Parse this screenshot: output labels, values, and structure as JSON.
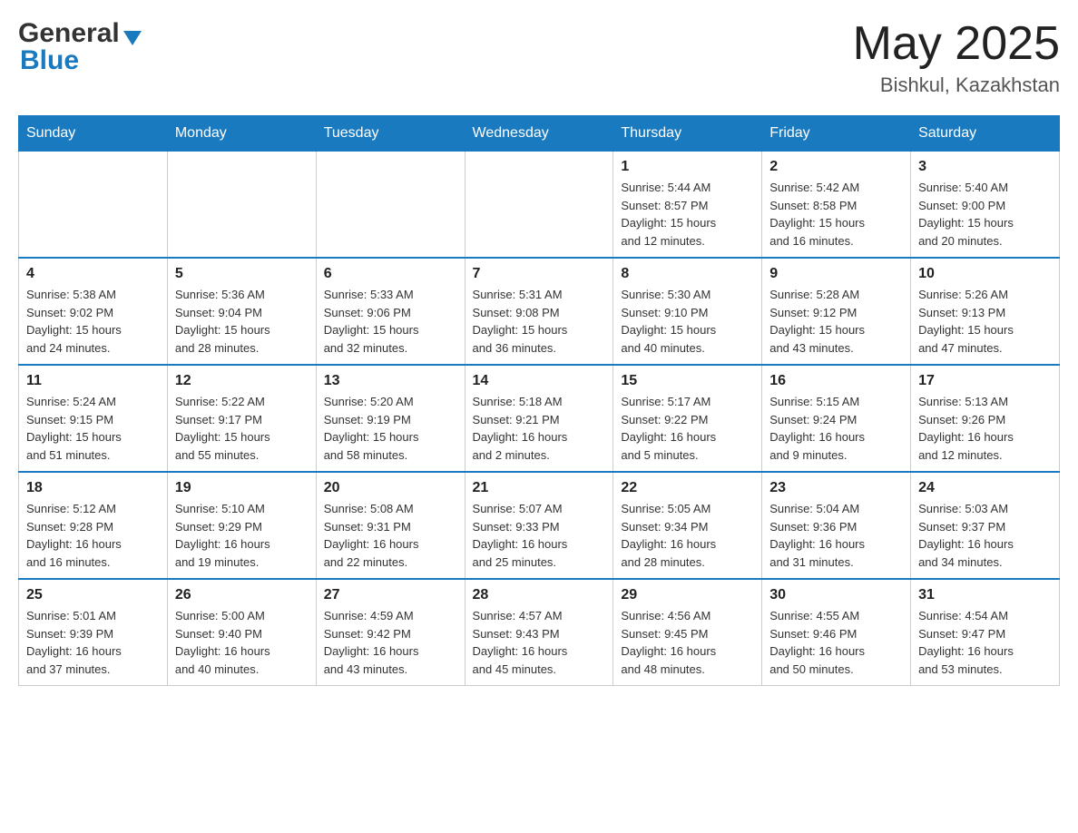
{
  "header": {
    "logo": {
      "general": "General",
      "blue": "Blue",
      "arrow": "arrow-down"
    },
    "title": "May 2025",
    "location": "Bishkul, Kazakhstan"
  },
  "calendar": {
    "days_of_week": [
      "Sunday",
      "Monday",
      "Tuesday",
      "Wednesday",
      "Thursday",
      "Friday",
      "Saturday"
    ],
    "weeks": [
      [
        {
          "day": "",
          "info": ""
        },
        {
          "day": "",
          "info": ""
        },
        {
          "day": "",
          "info": ""
        },
        {
          "day": "",
          "info": ""
        },
        {
          "day": "1",
          "info": "Sunrise: 5:44 AM\nSunset: 8:57 PM\nDaylight: 15 hours\nand 12 minutes."
        },
        {
          "day": "2",
          "info": "Sunrise: 5:42 AM\nSunset: 8:58 PM\nDaylight: 15 hours\nand 16 minutes."
        },
        {
          "day": "3",
          "info": "Sunrise: 5:40 AM\nSunset: 9:00 PM\nDaylight: 15 hours\nand 20 minutes."
        }
      ],
      [
        {
          "day": "4",
          "info": "Sunrise: 5:38 AM\nSunset: 9:02 PM\nDaylight: 15 hours\nand 24 minutes."
        },
        {
          "day": "5",
          "info": "Sunrise: 5:36 AM\nSunset: 9:04 PM\nDaylight: 15 hours\nand 28 minutes."
        },
        {
          "day": "6",
          "info": "Sunrise: 5:33 AM\nSunset: 9:06 PM\nDaylight: 15 hours\nand 32 minutes."
        },
        {
          "day": "7",
          "info": "Sunrise: 5:31 AM\nSunset: 9:08 PM\nDaylight: 15 hours\nand 36 minutes."
        },
        {
          "day": "8",
          "info": "Sunrise: 5:30 AM\nSunset: 9:10 PM\nDaylight: 15 hours\nand 40 minutes."
        },
        {
          "day": "9",
          "info": "Sunrise: 5:28 AM\nSunset: 9:12 PM\nDaylight: 15 hours\nand 43 minutes."
        },
        {
          "day": "10",
          "info": "Sunrise: 5:26 AM\nSunset: 9:13 PM\nDaylight: 15 hours\nand 47 minutes."
        }
      ],
      [
        {
          "day": "11",
          "info": "Sunrise: 5:24 AM\nSunset: 9:15 PM\nDaylight: 15 hours\nand 51 minutes."
        },
        {
          "day": "12",
          "info": "Sunrise: 5:22 AM\nSunset: 9:17 PM\nDaylight: 15 hours\nand 55 minutes."
        },
        {
          "day": "13",
          "info": "Sunrise: 5:20 AM\nSunset: 9:19 PM\nDaylight: 15 hours\nand 58 minutes."
        },
        {
          "day": "14",
          "info": "Sunrise: 5:18 AM\nSunset: 9:21 PM\nDaylight: 16 hours\nand 2 minutes."
        },
        {
          "day": "15",
          "info": "Sunrise: 5:17 AM\nSunset: 9:22 PM\nDaylight: 16 hours\nand 5 minutes."
        },
        {
          "day": "16",
          "info": "Sunrise: 5:15 AM\nSunset: 9:24 PM\nDaylight: 16 hours\nand 9 minutes."
        },
        {
          "day": "17",
          "info": "Sunrise: 5:13 AM\nSunset: 9:26 PM\nDaylight: 16 hours\nand 12 minutes."
        }
      ],
      [
        {
          "day": "18",
          "info": "Sunrise: 5:12 AM\nSunset: 9:28 PM\nDaylight: 16 hours\nand 16 minutes."
        },
        {
          "day": "19",
          "info": "Sunrise: 5:10 AM\nSunset: 9:29 PM\nDaylight: 16 hours\nand 19 minutes."
        },
        {
          "day": "20",
          "info": "Sunrise: 5:08 AM\nSunset: 9:31 PM\nDaylight: 16 hours\nand 22 minutes."
        },
        {
          "day": "21",
          "info": "Sunrise: 5:07 AM\nSunset: 9:33 PM\nDaylight: 16 hours\nand 25 minutes."
        },
        {
          "day": "22",
          "info": "Sunrise: 5:05 AM\nSunset: 9:34 PM\nDaylight: 16 hours\nand 28 minutes."
        },
        {
          "day": "23",
          "info": "Sunrise: 5:04 AM\nSunset: 9:36 PM\nDaylight: 16 hours\nand 31 minutes."
        },
        {
          "day": "24",
          "info": "Sunrise: 5:03 AM\nSunset: 9:37 PM\nDaylight: 16 hours\nand 34 minutes."
        }
      ],
      [
        {
          "day": "25",
          "info": "Sunrise: 5:01 AM\nSunset: 9:39 PM\nDaylight: 16 hours\nand 37 minutes."
        },
        {
          "day": "26",
          "info": "Sunrise: 5:00 AM\nSunset: 9:40 PM\nDaylight: 16 hours\nand 40 minutes."
        },
        {
          "day": "27",
          "info": "Sunrise: 4:59 AM\nSunset: 9:42 PM\nDaylight: 16 hours\nand 43 minutes."
        },
        {
          "day": "28",
          "info": "Sunrise: 4:57 AM\nSunset: 9:43 PM\nDaylight: 16 hours\nand 45 minutes."
        },
        {
          "day": "29",
          "info": "Sunrise: 4:56 AM\nSunset: 9:45 PM\nDaylight: 16 hours\nand 48 minutes."
        },
        {
          "day": "30",
          "info": "Sunrise: 4:55 AM\nSunset: 9:46 PM\nDaylight: 16 hours\nand 50 minutes."
        },
        {
          "day": "31",
          "info": "Sunrise: 4:54 AM\nSunset: 9:47 PM\nDaylight: 16 hours\nand 53 minutes."
        }
      ]
    ]
  }
}
